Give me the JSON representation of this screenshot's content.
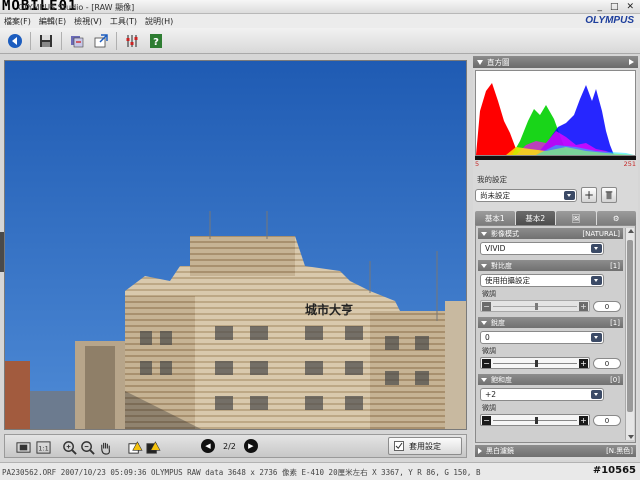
{
  "titlebar": {
    "watermark": "MOBILE01",
    "title": "OLYMPUS Studio - [RAW 顯像]"
  },
  "menu": {
    "items": [
      "檔案(F)",
      "編輯(E)",
      "檢視(V)",
      "工具(T)",
      "說明(H)"
    ],
    "brand": "OLYMPUS"
  },
  "toolbar": {
    "icons": [
      "back-icon",
      "save-icon",
      "batch-convert-icon",
      "export-icon",
      "adjust-icon",
      "help-icon"
    ]
  },
  "preview": {
    "building_text": "城市大亨",
    "sky_color": "#2a62b8"
  },
  "previewbar": {
    "page": "2/2",
    "apply_label": "套用設定"
  },
  "status": {
    "text": "PA230562.ORF   2007/10/23  05:09:36  OLYMPUS RAW data   3648 x 2736 像素  E-410  20厘米左右     X    3367, Y    R   86, G    150, B",
    "watermark": "#10565"
  },
  "panel": {
    "histogram_title": "直方圖",
    "hist_min": "5",
    "hist_max": "251",
    "preset_label": "我的設定",
    "preset_value": "尚未設定",
    "preset_add": "+",
    "tabs": [
      "基本1",
      "基本2",
      "🖼",
      "⚙"
    ],
    "sections": [
      {
        "title": "影像模式",
        "value": "[NATURAL]",
        "select": "VIVID"
      },
      {
        "title": "對比度",
        "value": "[1]",
        "select": "使用拍攝設定",
        "fine": "微調",
        "num": "0"
      },
      {
        "title": "銳度",
        "value": "[1]",
        "select": "0",
        "fine": "微調",
        "num": "0"
      },
      {
        "title": "飽和度",
        "value": "[0]",
        "select": "+2",
        "fine": "微調",
        "num": "0"
      }
    ],
    "footer": {
      "title": "黑白濾鏡",
      "value": "[N.黑色]"
    }
  },
  "colors": {
    "accent": "#1d3e9c",
    "panel_head": "#707070"
  }
}
